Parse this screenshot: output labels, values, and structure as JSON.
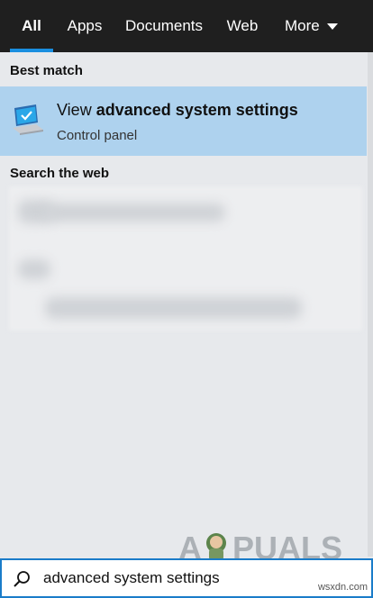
{
  "tabs": {
    "all": "All",
    "apps": "Apps",
    "documents": "Documents",
    "web": "Web",
    "more": "More"
  },
  "sections": {
    "best_match": "Best match",
    "search_web": "Search the web"
  },
  "best_result": {
    "title_prefix": "View ",
    "title_bold": "advanced system settings",
    "subtitle": "Control panel",
    "icon": "control-panel-monitor-icon"
  },
  "search": {
    "value": "advanced system settings",
    "icon": "search-icon"
  },
  "watermark": {
    "text": "APPUALS"
  },
  "site_tag": "wsxdn.com",
  "colors": {
    "topbar": "#1f1f1f",
    "accent": "#1a8fe0",
    "selected": "#aed2ee",
    "background": "#e7e9ec"
  }
}
